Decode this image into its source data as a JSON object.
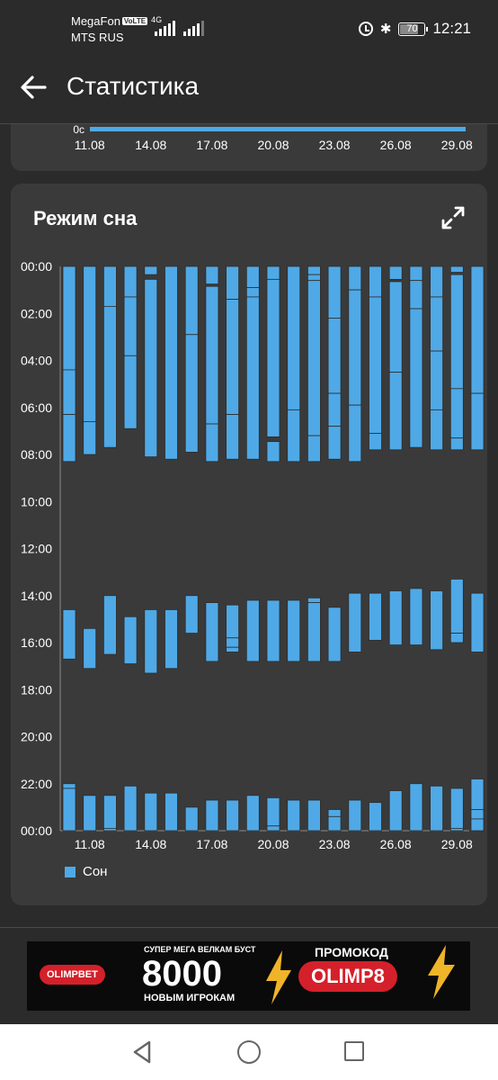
{
  "status_bar": {
    "carrier1": "MegaFon",
    "volte": "VoLTE",
    "network": "4G",
    "carrier2": "MTS RUS",
    "battery": "70",
    "time": "12:21"
  },
  "app_bar": {
    "back_icon": "arrow-left-icon",
    "title": "Статистика"
  },
  "prev_card": {
    "axis_label": "0c",
    "x_labels": [
      "11.08",
      "14.08",
      "17.08",
      "20.08",
      "23.08",
      "26.08",
      "29.08"
    ]
  },
  "sleep_card": {
    "title": "Режим сна",
    "expand_icon": "expand-icon",
    "legend": "Сон"
  },
  "chart_data": {
    "type": "bar",
    "title": "Режим сна",
    "y_axis_labels": [
      "00:00",
      "02:00",
      "04:00",
      "06:00",
      "08:00",
      "10:00",
      "12:00",
      "14:00",
      "16:00",
      "18:00",
      "20:00",
      "22:00",
      "00:00"
    ],
    "x_tick_labels": [
      "11.08",
      "14.08",
      "17.08",
      "20.08",
      "23.08",
      "26.08",
      "29.08"
    ],
    "ylim_hours": [
      0,
      24
    ],
    "legend": [
      "Сон"
    ],
    "color": "#4fa9e6",
    "series": [
      {
        "name": "Сон",
        "days": [
          {
            "day": "10.08",
            "sleeps": [
              [
                0,
                4.4
              ],
              [
                4.4,
                6.3
              ],
              [
                6.3,
                8.3
              ],
              [
                14.6,
                16.7
              ],
              [
                22,
                22.2
              ],
              [
                22.2,
                24
              ]
            ]
          },
          {
            "day": "11.08",
            "sleeps": [
              [
                0,
                6.6
              ],
              [
                6.6,
                8.0
              ],
              [
                15.4,
                17.1
              ],
              [
                22.5,
                24
              ]
            ]
          },
          {
            "day": "12.08",
            "sleeps": [
              [
                0,
                1.7
              ],
              [
                1.7,
                7.7
              ],
              [
                14.0,
                16.5
              ],
              [
                22.5,
                23.9
              ],
              [
                23.9,
                24
              ]
            ]
          },
          {
            "day": "13.08",
            "sleeps": [
              [
                0,
                1.3
              ],
              [
                1.3,
                3.8
              ],
              [
                3.8,
                6.9
              ],
              [
                14.9,
                16.9
              ],
              [
                22.1,
                24
              ]
            ]
          },
          {
            "day": "14.08",
            "sleeps": [
              [
                0,
                0.35
              ],
              [
                0.55,
                8.1
              ],
              [
                14.6,
                17.3
              ],
              [
                22.4,
                24
              ]
            ]
          },
          {
            "day": "15.08",
            "sleeps": [
              [
                0,
                8.2
              ],
              [
                14.6,
                17.1
              ],
              [
                22.4,
                24
              ]
            ]
          },
          {
            "day": "16.08",
            "sleeps": [
              [
                0,
                2.9
              ],
              [
                2.9,
                7.9
              ],
              [
                14.0,
                15.6
              ],
              [
                23.0,
                24
              ]
            ]
          },
          {
            "day": "17.08",
            "sleeps": [
              [
                0,
                0.75
              ],
              [
                0.85,
                6.7
              ],
              [
                6.7,
                8.3
              ],
              [
                14.3,
                16.8
              ],
              [
                22.7,
                24
              ]
            ]
          },
          {
            "day": "18.08",
            "sleeps": [
              [
                0,
                1.4
              ],
              [
                1.4,
                6.3
              ],
              [
                6.3,
                8.2
              ],
              [
                14.4,
                15.8
              ],
              [
                15.8,
                16.2
              ],
              [
                16.2,
                16.4
              ],
              [
                22.7,
                24
              ]
            ]
          },
          {
            "day": "19.08",
            "sleeps": [
              [
                0,
                0.9
              ],
              [
                0.9,
                1.3
              ],
              [
                1.3,
                8.2
              ],
              [
                14.2,
                16.8
              ],
              [
                22.5,
                24
              ]
            ]
          },
          {
            "day": "20.08",
            "sleeps": [
              [
                0,
                0.55
              ],
              [
                0.55,
                7.25
              ],
              [
                7.45,
                8.3
              ],
              [
                14.2,
                16.8
              ],
              [
                22.6,
                23.8
              ],
              [
                23.8,
                24
              ]
            ]
          },
          {
            "day": "21.08",
            "sleeps": [
              [
                0,
                6.1
              ],
              [
                6.1,
                8.3
              ],
              [
                14.2,
                16.8
              ],
              [
                22.7,
                24
              ]
            ]
          },
          {
            "day": "22.08",
            "sleeps": [
              [
                0,
                0.35
              ],
              [
                0.35,
                0.6
              ],
              [
                0.6,
                7.2
              ],
              [
                7.2,
                8.3
              ],
              [
                14.1,
                14.3
              ],
              [
                14.3,
                16.8
              ],
              [
                22.7,
                24
              ]
            ]
          },
          {
            "day": "23.08",
            "sleeps": [
              [
                0,
                2.2
              ],
              [
                2.2,
                5.4
              ],
              [
                5.4,
                6.8
              ],
              [
                6.8,
                8.2
              ],
              [
                14.5,
                16.8
              ],
              [
                23.1,
                23.4
              ],
              [
                23.4,
                24
              ]
            ]
          },
          {
            "day": "24.08",
            "sleeps": [
              [
                0,
                1.0
              ],
              [
                1.0,
                5.9
              ],
              [
                5.9,
                8.3
              ],
              [
                13.9,
                16.4
              ],
              [
                22.7,
                24
              ]
            ]
          },
          {
            "day": "25.08",
            "sleeps": [
              [
                0,
                1.3
              ],
              [
                1.3,
                7.1
              ],
              [
                7.1,
                7.8
              ],
              [
                13.9,
                15.9
              ],
              [
                22.8,
                24
              ]
            ]
          },
          {
            "day": "26.08",
            "sleeps": [
              [
                0,
                0.55
              ],
              [
                0.65,
                4.5
              ],
              [
                4.5,
                7.8
              ],
              [
                13.8,
                16.1
              ],
              [
                22.3,
                24
              ]
            ]
          },
          {
            "day": "27.08",
            "sleeps": [
              [
                0,
                0.6
              ],
              [
                0.6,
                1.8
              ],
              [
                1.8,
                7.7
              ],
              [
                13.7,
                16.1
              ],
              [
                22.0,
                24
              ]
            ]
          },
          {
            "day": "28.08",
            "sleeps": [
              [
                0,
                1.3
              ],
              [
                1.3,
                3.6
              ],
              [
                3.6,
                6.1
              ],
              [
                6.1,
                7.8
              ],
              [
                13.8,
                16.3
              ],
              [
                22.1,
                24
              ]
            ]
          },
          {
            "day": "29.08",
            "sleeps": [
              [
                0,
                0.25
              ],
              [
                0.35,
                5.2
              ],
              [
                5.2,
                7.3
              ],
              [
                7.3,
                7.8
              ],
              [
                13.3,
                15.6
              ],
              [
                15.6,
                16.0
              ],
              [
                22.2,
                23.9
              ],
              [
                23.9,
                24
              ]
            ]
          },
          {
            "day": "30.08",
            "sleeps": [
              [
                0,
                5.4
              ],
              [
                5.4,
                7.8
              ],
              [
                13.9,
                16.4
              ],
              [
                21.8,
                23.1
              ],
              [
                23.1,
                23.5
              ],
              [
                23.5,
                24
              ]
            ]
          }
        ]
      }
    ]
  },
  "ad": {
    "brand": "OLIMPBET",
    "top_line": "СУПЕР МЕГА ВЕЛКАМ БУСТ",
    "amount": "8000",
    "sub_line": "НОВЫМ ИГРОКАМ",
    "promo_label": "ПРОМОКОД",
    "promo_code": "OLIMP8"
  },
  "nav_bar": {
    "back": "nav-back-icon",
    "home": "nav-home-icon",
    "recent": "nav-recent-icon"
  }
}
